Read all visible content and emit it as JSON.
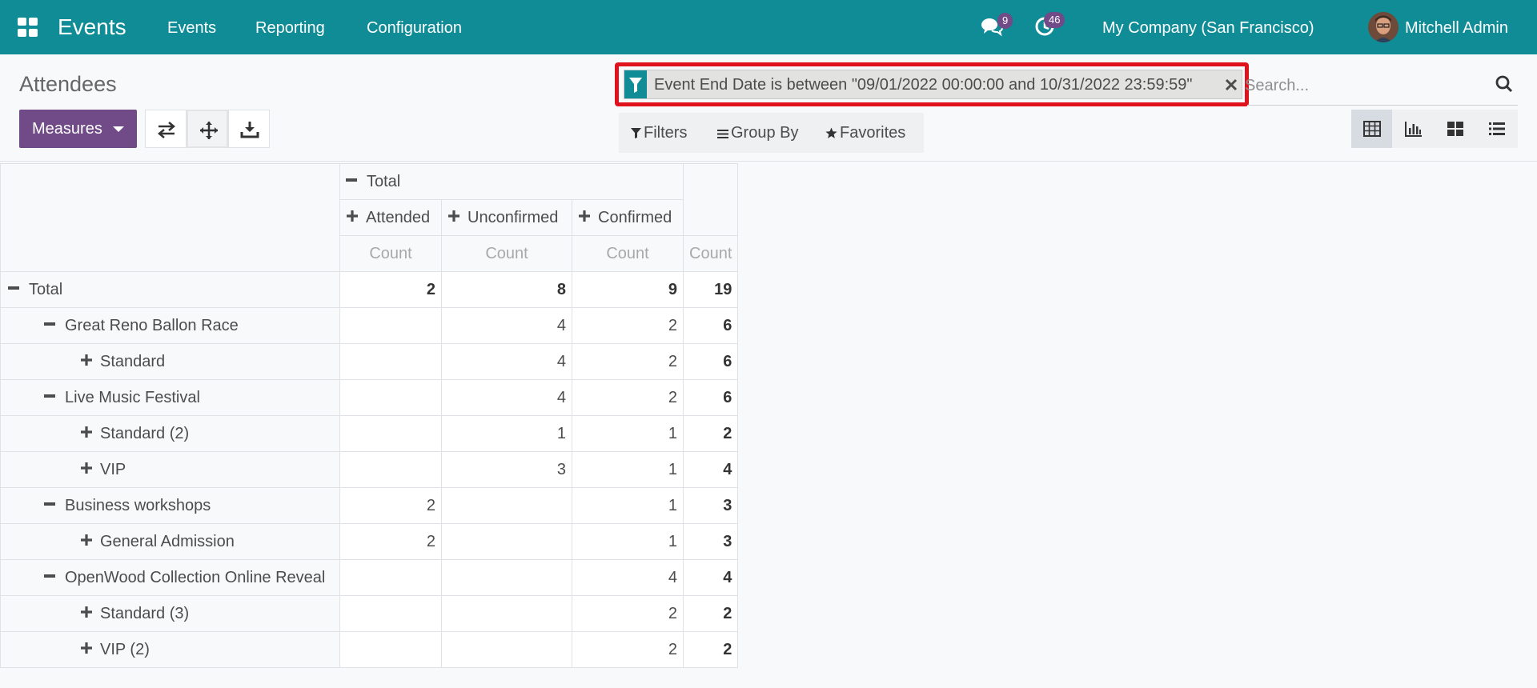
{
  "navbar": {
    "app_name": "Events",
    "menu": [
      "Events",
      "Reporting",
      "Configuration"
    ],
    "messages_count": "9",
    "activities_count": "46",
    "company": "My Company (San Francisco)",
    "user": "Mitchell Admin",
    "brand_color": "#0f8c96",
    "badge_color": "#714b87"
  },
  "control_panel": {
    "breadcrumb": "Attendees",
    "measures_label": "Measures",
    "search": {
      "facet_label": "Event End Date is between \"09/01/2022 00:00:00 and 10/31/2022 23:59:59\"",
      "placeholder": "Search..."
    },
    "filters_label": "Filters",
    "groupby_label": "Group By",
    "favorites_label": "Favorites",
    "accent_color": "#714b87",
    "highlight_color": "#e0121c"
  },
  "pivot": {
    "column_total_label": "Total",
    "columns": [
      "Attended",
      "Unconfirmed",
      "Confirmed"
    ],
    "measure_label": "Count",
    "rows": [
      {
        "label": "Total",
        "values": [
          "2",
          "8",
          "9"
        ],
        "total": "19"
      },
      {
        "label": "Great Reno Ballon Race",
        "values": [
          "",
          "4",
          "2"
        ],
        "total": "6"
      },
      {
        "label": "Standard",
        "values": [
          "",
          "4",
          "2"
        ],
        "total": "6"
      },
      {
        "label": "Live Music Festival",
        "values": [
          "",
          "4",
          "2"
        ],
        "total": "6"
      },
      {
        "label": "Standard (2)",
        "values": [
          "",
          "1",
          "1"
        ],
        "total": "2"
      },
      {
        "label": "VIP",
        "values": [
          "",
          "3",
          "1"
        ],
        "total": "4"
      },
      {
        "label": "Business workshops",
        "values": [
          "2",
          "",
          "1"
        ],
        "total": "3"
      },
      {
        "label": "General Admission",
        "values": [
          "2",
          "",
          "1"
        ],
        "total": "3"
      },
      {
        "label": "OpenWood Collection Online Reveal",
        "values": [
          "",
          "",
          "4"
        ],
        "total": "4"
      },
      {
        "label": "Standard (3)",
        "values": [
          "",
          "",
          "2"
        ],
        "total": "2"
      },
      {
        "label": "VIP (2)",
        "values": [
          "",
          "",
          "2"
        ],
        "total": "2"
      }
    ]
  }
}
